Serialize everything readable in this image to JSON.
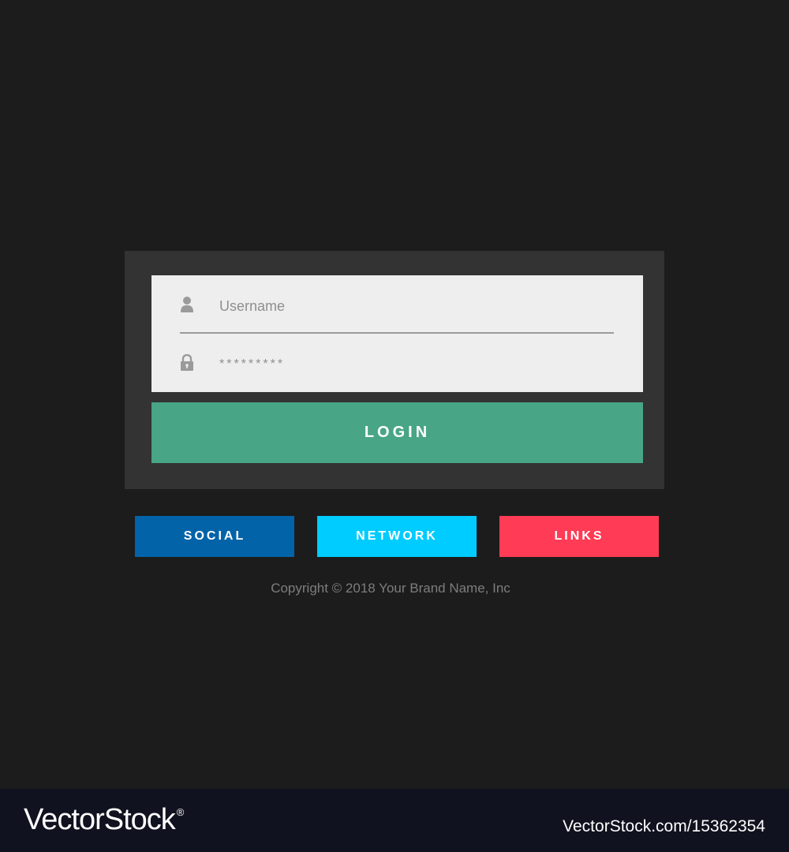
{
  "login_form": {
    "username_placeholder": "Username",
    "password_value": "*********",
    "login_label": "LOGIN",
    "icons": {
      "username": "user-icon",
      "password": "lock-icon"
    }
  },
  "social_links": {
    "items": [
      {
        "label": "SOCIAL",
        "color": "#0263a8"
      },
      {
        "label": "NETWORK",
        "color": "#00ccff"
      },
      {
        "label": "LINKS",
        "color": "#ff3b55"
      }
    ]
  },
  "copyright": "Copyright © 2018 Your Brand Name, Inc",
  "watermark": {
    "brand": "VectorStock",
    "registered_mark": "®",
    "url_id": "VectorStock.com/15362354"
  },
  "colors": {
    "background": "#1c1c1c",
    "card": "#333333",
    "fields": "#eeeeee",
    "login_button": "#48a586",
    "footer": "#10121f"
  }
}
